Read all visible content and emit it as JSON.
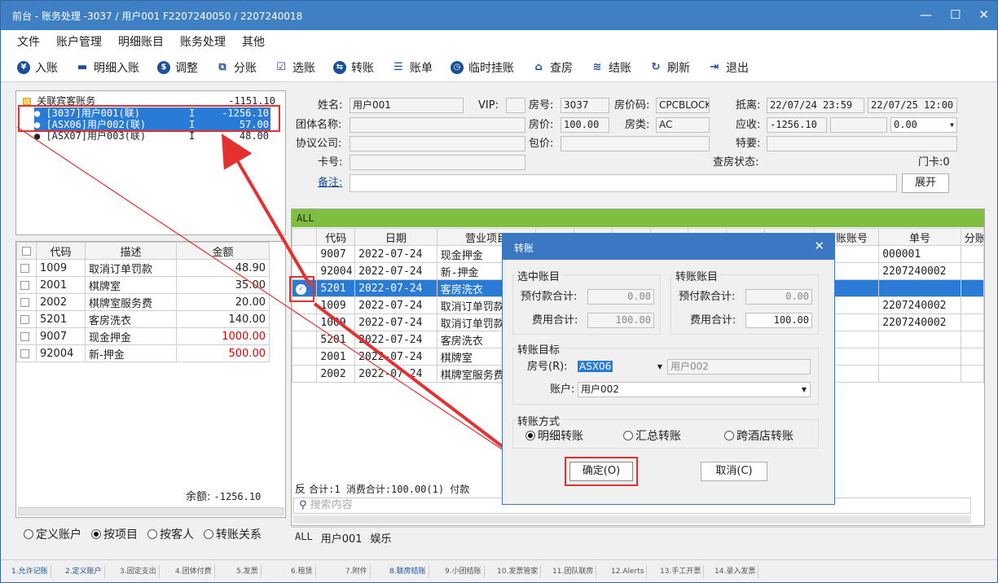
{
  "window": {
    "title": "前台 - 账务处理 -3037 / 用户001 F2207240050 / 2207240018",
    "minimize": "—",
    "maximize": "☐",
    "close": "✕"
  },
  "menu": [
    "文件",
    "账户管理",
    "明细账目",
    "账务处理",
    "其他"
  ],
  "toolbar": [
    {
      "label": "入账",
      "icon": "yen-icon"
    },
    {
      "label": "明细入账",
      "icon": "card-icon"
    },
    {
      "label": "调整",
      "icon": "dollar-icon"
    },
    {
      "label": "分账",
      "icon": "split-icon"
    },
    {
      "label": "选账",
      "icon": "select-icon"
    },
    {
      "label": "转账",
      "icon": "transfer-icon"
    },
    {
      "label": "账单",
      "icon": "bill-icon"
    },
    {
      "label": "临时挂账",
      "icon": "clock-icon"
    },
    {
      "label": "查房",
      "icon": "house-icon"
    },
    {
      "label": "结账",
      "icon": "coins-icon"
    },
    {
      "label": "刷新",
      "icon": "refresh-icon"
    },
    {
      "label": "退出",
      "icon": "exit-icon"
    }
  ],
  "tree": {
    "root_label": "关联宾客账务",
    "root_amount": "-1151.10",
    "items": [
      {
        "name": "[3037]用户001(联)",
        "flag": "I",
        "amount": "-1256.10"
      },
      {
        "name": "[ASX06]用户002(联)",
        "flag": "I",
        "amount": "57.00"
      },
      {
        "name": "[ASX07]用户003(联)",
        "flag": "I",
        "amount": "48.00"
      }
    ]
  },
  "items_table": {
    "headers": [
      "代码",
      "描述",
      "金额"
    ],
    "rows": [
      {
        "code": "1009",
        "desc": "取消订单罚款",
        "amount": "48.90",
        "red": false
      },
      {
        "code": "2001",
        "desc": "棋牌室",
        "amount": "35.00",
        "red": false
      },
      {
        "code": "2002",
        "desc": "棋牌室服务费",
        "amount": "20.00",
        "red": false
      },
      {
        "code": "5201",
        "desc": "客房洗衣",
        "amount": "140.00",
        "red": false
      },
      {
        "code": "9007",
        "desc": "现金押金",
        "amount": "1000.00",
        "red": true
      },
      {
        "code": "92004",
        "desc": "新-押金",
        "amount": "500.00",
        "red": true
      }
    ],
    "balance_label": "余额:",
    "balance_value": "-1256.10"
  },
  "left_radios": [
    {
      "label": "定义账户",
      "on": false
    },
    {
      "label": "按项目",
      "on": true
    },
    {
      "label": "按客人",
      "on": false
    },
    {
      "label": "转账关系",
      "on": false
    }
  ],
  "guest": {
    "name_label": "姓名:",
    "name": "用户001",
    "vip_label": "VIP:",
    "room_label": "房号:",
    "room": "3037",
    "rate_code_label": "房价码:",
    "rate_code": "CPCBLOCK",
    "arrive_label": "抵离:",
    "arrive": "22/07/24 23:59",
    "depart": "22/07/25 12:00",
    "group_label": "团体名称:",
    "price_label": "房价:",
    "price": "100.00",
    "room_type_label": "房类:",
    "room_type": "AC",
    "receivable_label": "应收:",
    "receivable": "-1256.10",
    "dropdown_value": "0.00",
    "company_label": "协议公司:",
    "package_label": "包价:",
    "special_label": "特要:",
    "card_label": "卡号:",
    "inspect_label": "查房状态:",
    "door_card": "门卡:0",
    "notes_label": "备注:",
    "expand_btn": "展开"
  },
  "trans_table": {
    "filter": "ALL",
    "headers": [
      "代码",
      "日期",
      "营业项目",
      "",
      "",
      "",
      "",
      "",
      "",
      "",
      "转账账号",
      "单号",
      "分账"
    ],
    "rows": [
      {
        "code": "9007",
        "date": "2022-07-24",
        "item": "现金押金",
        "order": "000001",
        "sel": false
      },
      {
        "code": "92004",
        "date": "2022-07-24",
        "item": "新-押金",
        "order": "2207240002",
        "sel": false
      },
      {
        "code": "5201",
        "date": "2022-07-24",
        "item": "客房洗衣",
        "order": "",
        "sel": true
      },
      {
        "code": "1009",
        "date": "2022-07-24",
        "item": "取消订单罚款",
        "order": "2207240002",
        "sel": false
      },
      {
        "code": "1009",
        "date": "2022-07-24",
        "item": "取消订单罚款",
        "order": "2207240002",
        "sel": false
      },
      {
        "code": "5201",
        "date": "2022-07-24",
        "item": "客房洗衣",
        "order": "",
        "sel": false
      },
      {
        "code": "2001",
        "date": "2022-07-24",
        "item": "棋牌室",
        "order": "",
        "sel": false
      },
      {
        "code": "2002",
        "date": "2022-07-24",
        "item": "棋牌室服务费",
        "order": "",
        "sel": false
      }
    ],
    "summary_prefix": "反",
    "summary": "合计:1  消费合计:100.00(1)  付款",
    "search_placeholder": "搜索内容",
    "tabs": [
      "ALL",
      "用户001",
      "娱乐"
    ]
  },
  "dialog": {
    "title": "转账",
    "selected_group": "选中账目",
    "target_acct_group": "转账账目",
    "prepay_label": "预付款合计:",
    "prepay_selected": "0.00",
    "fee_label": "费用合计:",
    "fee_selected": "100.00",
    "prepay_target": "0.00",
    "fee_target": "100.00",
    "target_group": "转账目标",
    "room_label": "房号(R):",
    "room_value": "ASX06",
    "room_guest": "用户002",
    "account_label": "账户:",
    "account_value": "用户002",
    "method_group": "转账方式",
    "methods": [
      {
        "label": "明细转账",
        "on": true
      },
      {
        "label": "汇总转账",
        "on": false
      },
      {
        "label": "跨酒店转账",
        "on": false
      }
    ],
    "ok": "确定(O)",
    "cancel": "取消(C)"
  },
  "status_tabs": [
    {
      "label": "1.允许记账",
      "blue": true
    },
    {
      "label": "2.定义账户",
      "blue": true
    },
    {
      "label": "3.固定支出",
      "blue": false
    },
    {
      "label": "4.团体付费",
      "blue": false
    },
    {
      "label": "5.发票",
      "blue": false
    },
    {
      "label": "6.租赁",
      "blue": false
    },
    {
      "label": "7.附件",
      "blue": false
    },
    {
      "label": "8.联房结账",
      "blue": true
    },
    {
      "label": "9.小团结账",
      "blue": false
    },
    {
      "label": "10.发票管家",
      "blue": false
    },
    {
      "label": "11.团队联房",
      "blue": false
    },
    {
      "label": "12.Alerts",
      "blue": false
    },
    {
      "label": "13.手工开票",
      "blue": false
    },
    {
      "label": "14.录入发票",
      "blue": false
    }
  ],
  "colors": {
    "title_bar": "#3f7fc4",
    "selection": "#2a7bd6",
    "annotation_red": "#e53030",
    "filter_bar": "#7fbf3f"
  }
}
